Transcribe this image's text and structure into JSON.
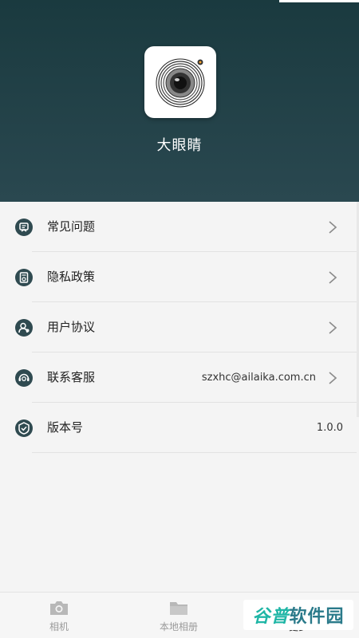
{
  "app": {
    "name": "大眼睛",
    "icon": "camera-lens-icon"
  },
  "menu": {
    "items": [
      {
        "label": "常见问题",
        "icon": "faq-icon",
        "value": "",
        "chevron": true
      },
      {
        "label": "隐私政策",
        "icon": "privacy-icon",
        "value": "",
        "chevron": true
      },
      {
        "label": "用户协议",
        "icon": "user-agreement-icon",
        "value": "",
        "chevron": true
      },
      {
        "label": "联系客服",
        "icon": "customer-service-icon",
        "value": "szxhc@ailaika.com.cn",
        "chevron": true
      },
      {
        "label": "版本号",
        "icon": "version-icon",
        "value": "1.0.0",
        "chevron": false
      }
    ]
  },
  "tabbar": {
    "tabs": [
      {
        "label": "相机",
        "icon": "camera-icon"
      },
      {
        "label": "本地相册",
        "icon": "folder-icon"
      },
      {
        "label": "更多",
        "icon": "person-icon"
      }
    ]
  },
  "watermark": {
    "part_a": "谷普",
    "part_b": "软件园"
  },
  "colors": {
    "header_top": "#1a3a3f",
    "header_bottom": "#2a4850",
    "list_bg": "#f4f4f4",
    "icon_dark": "#2f4a50"
  }
}
